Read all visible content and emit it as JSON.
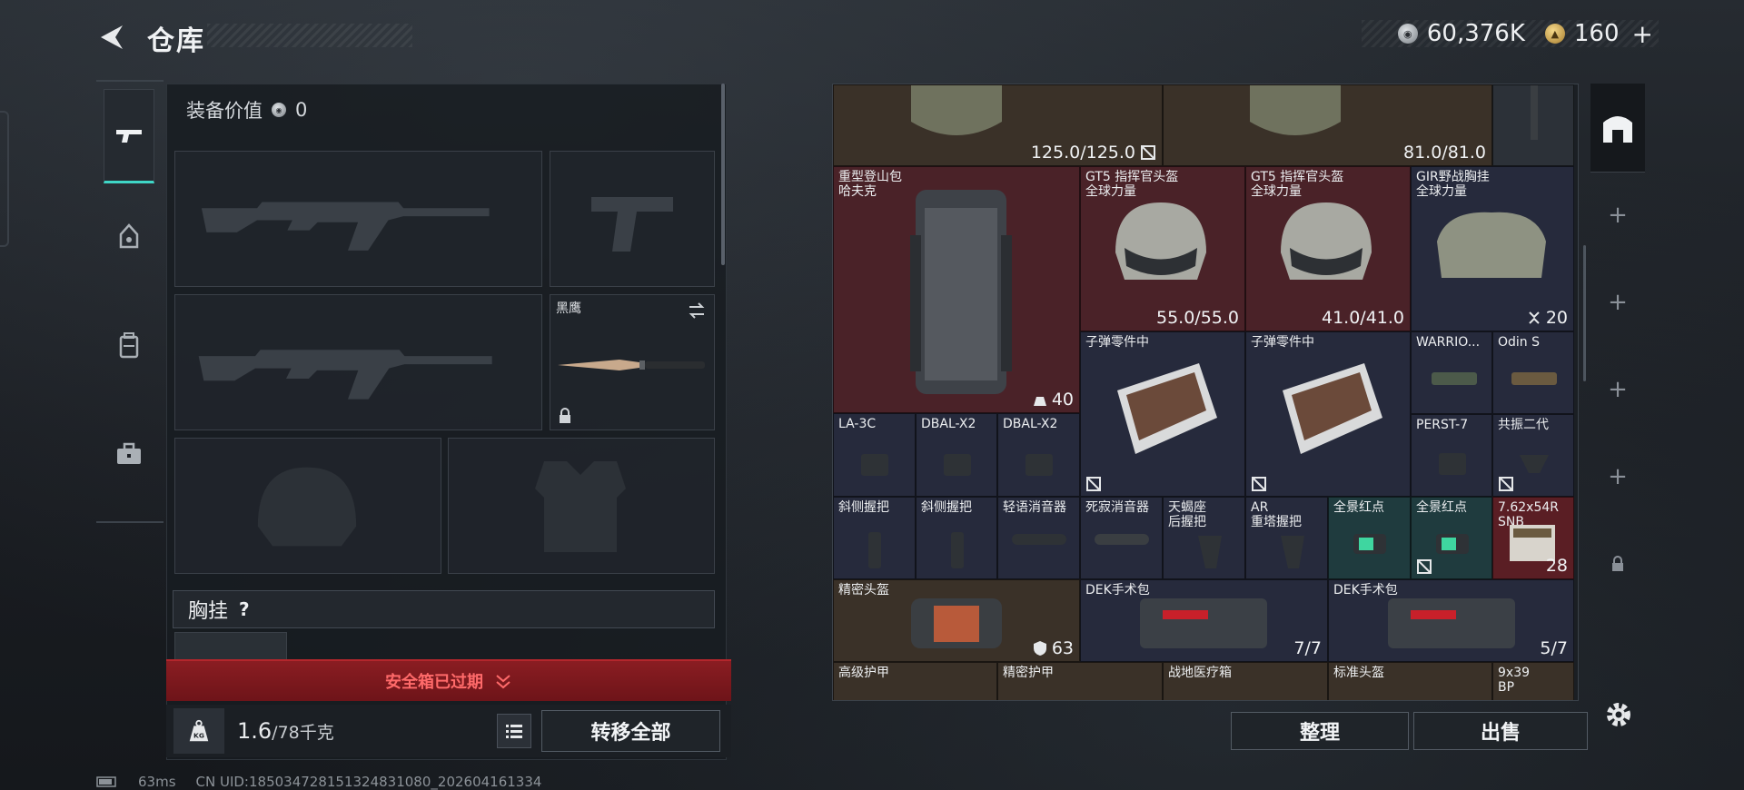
{
  "header": {
    "title": "仓库",
    "currency_1": "60,376K",
    "currency_2": "160",
    "add_symbol": "+"
  },
  "equipment": {
    "value_label": "装备价值",
    "value": "0",
    "knife_name": "黑鹰",
    "chest_label": "胸挂",
    "chest_help": "?",
    "expired_text": "安全箱已过期",
    "weight_current": "1.6",
    "weight_max": "/78千克",
    "move_all_label": "转移全部"
  },
  "storage": {
    "top_row": [
      {
        "num": "125.0/125.0"
      },
      {
        "num": "81.0/81.0"
      }
    ],
    "items": [
      {
        "name": "重型登山包\n哈夫克",
        "num": "40"
      },
      {
        "name": "GT5 指挥官头盔\n全球力量",
        "num": "55.0/55.0"
      },
      {
        "name": "GT5 指挥官头盔\n全球力量",
        "num": "41.0/41.0"
      },
      {
        "name": "GIR野战胸挂\n全球力量",
        "num": "20"
      },
      {
        "name": "子弹零件中"
      },
      {
        "name": "子弹零件中"
      },
      {
        "name": "WARRIO..."
      },
      {
        "name": "Odin S"
      },
      {
        "name": "LA-3C"
      },
      {
        "name": "DBAL-X2"
      },
      {
        "name": "DBAL-X2"
      },
      {
        "name": "PERST-7"
      },
      {
        "name": "共振二代"
      },
      {
        "name": "斜侧握把"
      },
      {
        "name": "斜侧握把"
      },
      {
        "name": "轻语消音器"
      },
      {
        "name": "死寂消音器"
      },
      {
        "name": "天蝎座\n后握把"
      },
      {
        "name": "AR\n重塔握把"
      },
      {
        "name": "全景红点"
      },
      {
        "name": "全景红点"
      },
      {
        "name": "7.62x54R\nSNB",
        "num": "28"
      },
      {
        "name": "精密头盔",
        "num": "63"
      },
      {
        "name": "DEK手术包",
        "num": "7/7"
      },
      {
        "name": "DEK手术包",
        "num": "5/7"
      },
      {
        "name": "高级护甲"
      },
      {
        "name": "精密护甲"
      },
      {
        "name": "战地医疗箱"
      },
      {
        "name": "标准头盔"
      },
      {
        "name": "9x39\nBP"
      }
    ],
    "sort_label": "整理",
    "sell_label": "出售"
  },
  "status": {
    "ping": "63ms",
    "uid": "CN UID:185034728151324831080_202604161334"
  }
}
